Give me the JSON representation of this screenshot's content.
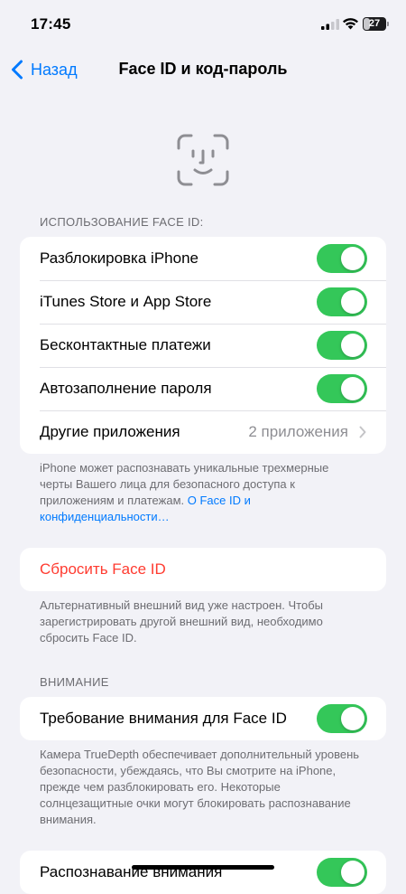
{
  "status_bar": {
    "time": "17:45",
    "battery_level": "27"
  },
  "nav": {
    "back_label": "Назад",
    "title": "Face ID и код-пароль"
  },
  "face_id_section": {
    "header": "Использование Face ID:",
    "rows": [
      {
        "label": "Разблокировка iPhone",
        "toggle_on": true
      },
      {
        "label": "iTunes Store и App Store",
        "toggle_on": true
      },
      {
        "label": "Бесконтактные платежи",
        "toggle_on": true
      },
      {
        "label": "Автозаполнение пароля",
        "toggle_on": true
      }
    ],
    "other_apps": {
      "label": "Другие приложения",
      "value": "2 приложения"
    },
    "footer_text": "iPhone может распознавать уникальные трехмерные черты Вашего лица для безопасного доступа к приложениям и платежам.",
    "footer_link": "О Face ID и конфиденциальности…"
  },
  "reset": {
    "label": "Сбросить Face ID",
    "footer_text": "Альтернативный внешний вид уже настроен. Чтобы зарегистрировать другой внешний вид, необходимо сбросить Face ID."
  },
  "attention_section": {
    "header": "Внимание",
    "require_attention": {
      "label": "Требование внимания для Face ID",
      "toggle_on": true
    },
    "footer_text": "Камера TrueDepth обеспечивает дополнительный уровень безопасности, убеждаясь, что Вы смотрите на iPhone, прежде чем разблокировать его. Некоторые солнцезащитные очки могут блокировать распознавание внимания.",
    "attention_aware": {
      "label": "Распознавание внимания",
      "toggle_on": true
    }
  },
  "colors": {
    "accent": "#007aff",
    "toggle_on": "#34c759",
    "destructive": "#ff3b30",
    "background": "#f2f2f7"
  }
}
